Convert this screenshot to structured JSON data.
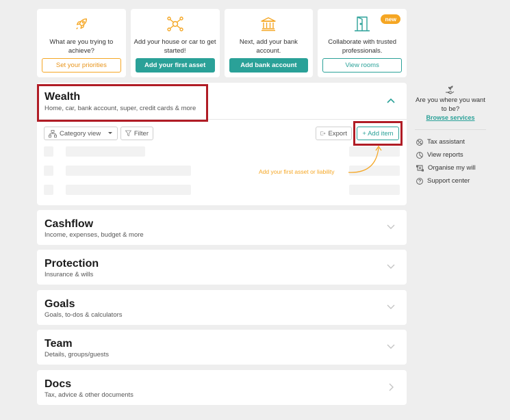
{
  "cards": [
    {
      "text": "What are you trying to achieve?",
      "button": "Set your priorities",
      "icon": "rocket-icon"
    },
    {
      "text": "Add your house or car to get started!",
      "button": "Add your first asset",
      "icon": "network-icon"
    },
    {
      "text": "Next, add your bank account.",
      "button": "Add bank account",
      "icon": "bank-icon"
    },
    {
      "text": "Collaborate with trusted professionals.",
      "button": "View rooms",
      "icon": "door-icon",
      "badge": "new"
    }
  ],
  "wealth": {
    "title": "Wealth",
    "subtitle": "Home, car, bank account, super, credit cards & more",
    "category_view": "Category view",
    "filter": "Filter",
    "export": "Export",
    "add_item": "+ Add item",
    "annotation": "Add your first asset or liability"
  },
  "sections": [
    {
      "title": "Cashflow",
      "subtitle": "Income, expenses, budget & more"
    },
    {
      "title": "Protection",
      "subtitle": "Insurance & wills"
    },
    {
      "title": "Goals",
      "subtitle": "Goals, to-dos & calculators"
    },
    {
      "title": "Team",
      "subtitle": "Details, groups/guests"
    },
    {
      "title": "Docs",
      "subtitle": "Tax, advice & other documents"
    }
  ],
  "sidebar": {
    "question": "Are you where you want to be?",
    "browse": "Browse services",
    "links": [
      {
        "label": "Tax assistant",
        "icon": "percent-icon"
      },
      {
        "label": "View reports",
        "icon": "reports-icon"
      },
      {
        "label": "Organise my will",
        "icon": "scroll-icon"
      },
      {
        "label": "Support center",
        "icon": "help-icon"
      }
    ]
  },
  "colors": {
    "teal": "#2aa198",
    "orange": "#f5a623",
    "highlight": "#b01c25"
  }
}
